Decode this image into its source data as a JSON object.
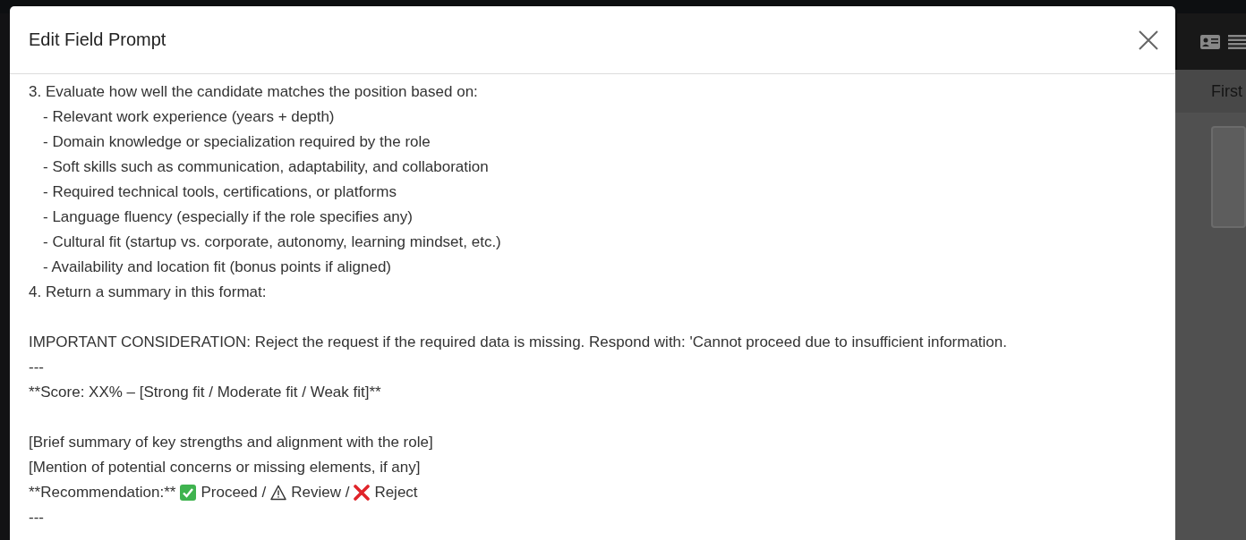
{
  "background": {
    "breadcrumb": "First"
  },
  "dialog": {
    "title": "Edit Field Prompt",
    "lines": [
      {
        "kind": "line",
        "text": "3. Evaluate how well the candidate matches the position based on:"
      },
      {
        "kind": "item",
        "text": "- Relevant work experience (years + depth)"
      },
      {
        "kind": "item",
        "text": "- Domain knowledge or specialization required by the role"
      },
      {
        "kind": "item",
        "text": "- Soft skills such as communication, adaptability, and collaboration"
      },
      {
        "kind": "item",
        "text": "- Required technical tools, certifications, or platforms"
      },
      {
        "kind": "item",
        "text": "- Language fluency (especially if the role specifies any)"
      },
      {
        "kind": "item",
        "text": "- Cultural fit (startup vs. corporate, autonomy, learning mindset, etc.)"
      },
      {
        "kind": "item",
        "text": "- Availability and location fit (bonus points if aligned)"
      },
      {
        "kind": "line",
        "text": "4. Return a summary in this format:"
      },
      {
        "kind": "blank"
      },
      {
        "kind": "line",
        "text": "IMPORTANT CONSIDERATION: Reject the request if the required data is missing. Respond with: 'Cannot proceed due to insufficient information."
      },
      {
        "kind": "line",
        "text": "---"
      },
      {
        "kind": "line",
        "text": "**Score: XX% – [Strong fit / Moderate fit / Weak fit]**"
      },
      {
        "kind": "blank"
      },
      {
        "kind": "line",
        "text": "[Brief summary of key strengths and alignment with the role]"
      },
      {
        "kind": "line",
        "text": "[Mention of potential concerns or missing elements, if any]"
      },
      {
        "kind": "mixed",
        "parts": [
          {
            "kind": "text",
            "text": "**Recommendation:**"
          },
          {
            "kind": "check"
          },
          {
            "kind": "text",
            "text": "Proceed /"
          },
          {
            "kind": "warning"
          },
          {
            "kind": "text",
            "text": "Review /"
          },
          {
            "kind": "cross"
          },
          {
            "kind": "text",
            "text": "Reject"
          }
        ]
      },
      {
        "kind": "line",
        "text": "---"
      }
    ]
  }
}
